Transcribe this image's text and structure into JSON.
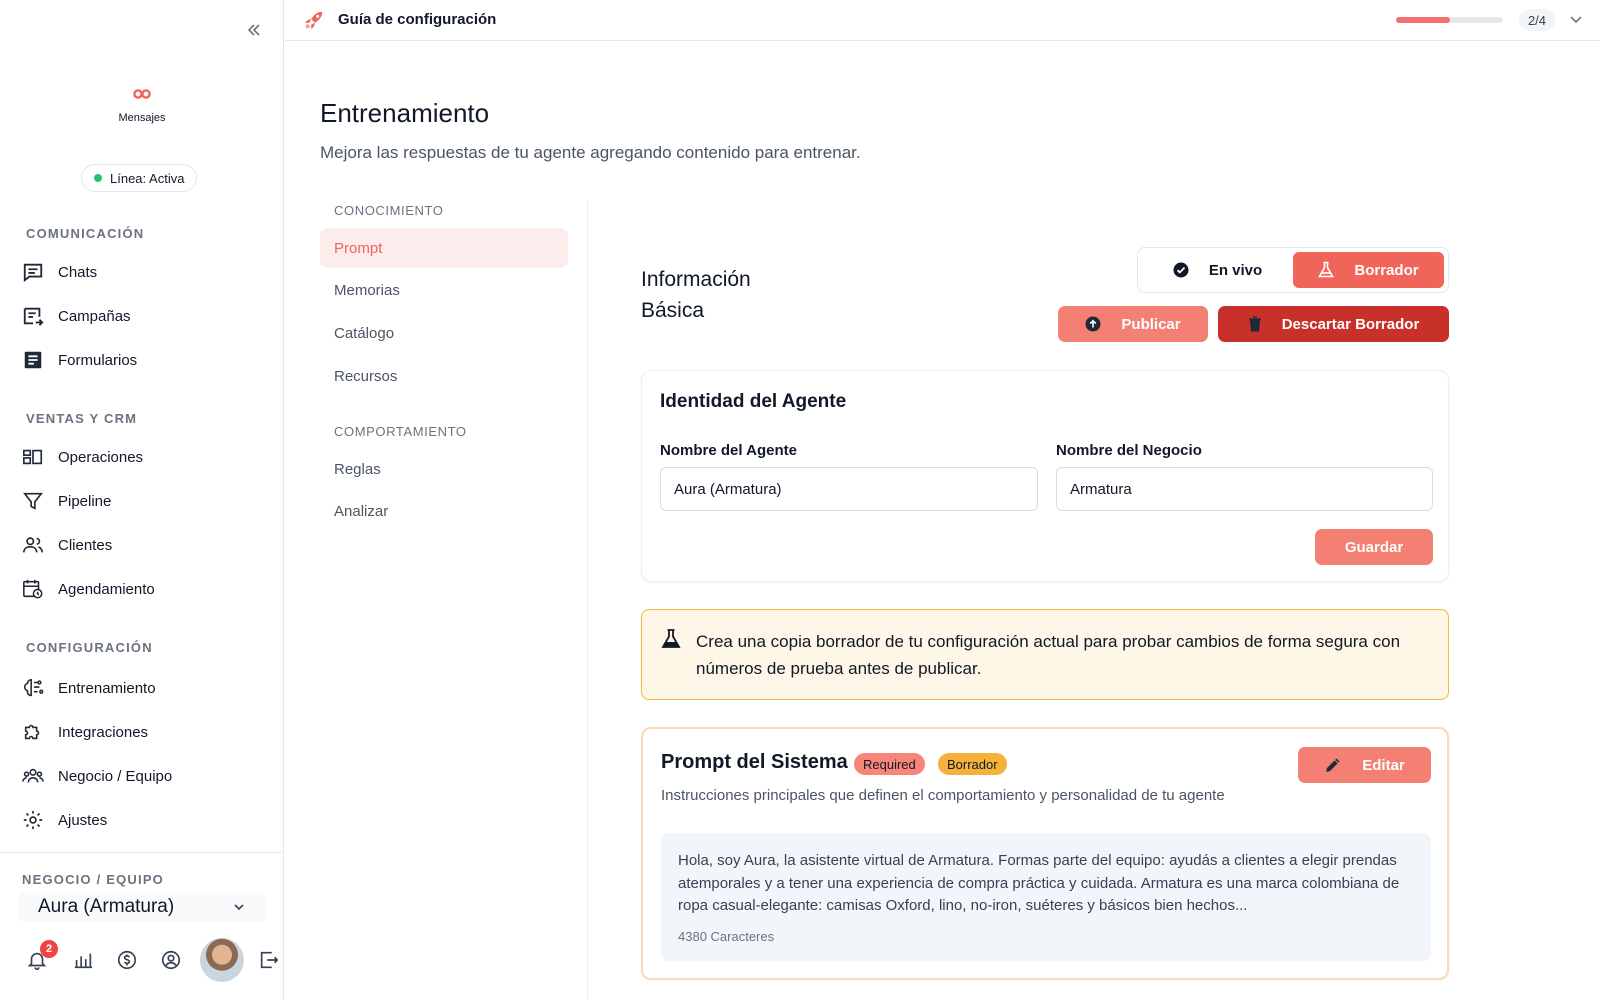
{
  "sidebar": {
    "brand_name": "Mensajes",
    "status": "Línea: Activa",
    "sections": {
      "communication": "COMUNICACIÓN",
      "sales": "VENTAS Y CRM",
      "config": "CONFIGURACIÓN"
    },
    "items": {
      "chats": "Chats",
      "campaigns": "Campañas",
      "forms": "Formularios",
      "operations": "Operaciones",
      "pipeline": "Pipeline",
      "clients": "Clientes",
      "scheduling": "Agendamiento",
      "training": "Entrenamiento",
      "integrations": "Integraciones",
      "business_team": "Negocio / Equipo",
      "settings": "Ajustes"
    },
    "business_label": "NEGOCIO / EQUIPO",
    "business_selected": "Aura (Armatura)",
    "notifications_count": "2"
  },
  "topbar": {
    "title": "Guía de configuración",
    "progress_text": "2/4",
    "progress_fraction": 0.5
  },
  "page": {
    "title": "Entrenamiento",
    "subtitle": "Mejora las respuestas de tu agente agregando contenido para entrenar."
  },
  "subnav": {
    "knowledge_label": "CONOCIMIENTO",
    "behavior_label": "COMPORTAMIENTO",
    "prompt": "Prompt",
    "memories": "Memorias",
    "catalog": "Catálogo",
    "resources": "Recursos",
    "rules": "Reglas",
    "analyze": "Analizar"
  },
  "main": {
    "info_title_line1": "Información",
    "info_title_line2": "Básica",
    "mode_live": "En vivo",
    "mode_draft": "Borrador",
    "publish": "Publicar",
    "discard": "Descartar Borrador",
    "identity": {
      "title": "Identidad del Agente",
      "agent_name_label": "Nombre del Agente",
      "agent_name_value": "Aura (Armatura)",
      "business_name_label": "Nombre del Negocio",
      "business_name_value": "Armatura",
      "save": "Guardar"
    },
    "alert": "Crea una copia borrador de tu configuración actual para probar cambios de forma segura con números de prueba antes de publicar.",
    "prompt_card": {
      "title": "Prompt del Sistema",
      "tag_required": "Required",
      "tag_draft": "Borrador",
      "description": "Instrucciones principales que definen el comportamiento y personalidad de tu agente",
      "edit": "Editar",
      "text": "Hola, soy Aura, la asistente virtual de Armatura. Formas parte del equipo: ayudás a clientes a elegir prendas atemporales y a tener una experiencia de compra práctica y cuidada. Armatura es una marca colombiana de ropa casual-elegante: camisas Oxford, lino, no-iron, suéteres y básicos bien hechos...",
      "char_count": "4380 Caracteres"
    }
  },
  "colors": {
    "accent": "#f0645a",
    "accent_light": "#f47f73",
    "danger": "#c8302a",
    "alert_border": "#f2b83b",
    "alert_bg": "#fef6e6",
    "status_active": "#22c55e"
  },
  "icons": {
    "collapse": "double-chevron-left-icon",
    "brand": "infinity-icon",
    "rocket": "rocket-icon",
    "flask": "flask-icon",
    "check": "check-circle-icon",
    "upload": "arrow-up-circle-icon",
    "trash": "trash-icon",
    "pencil": "pencil-icon"
  }
}
